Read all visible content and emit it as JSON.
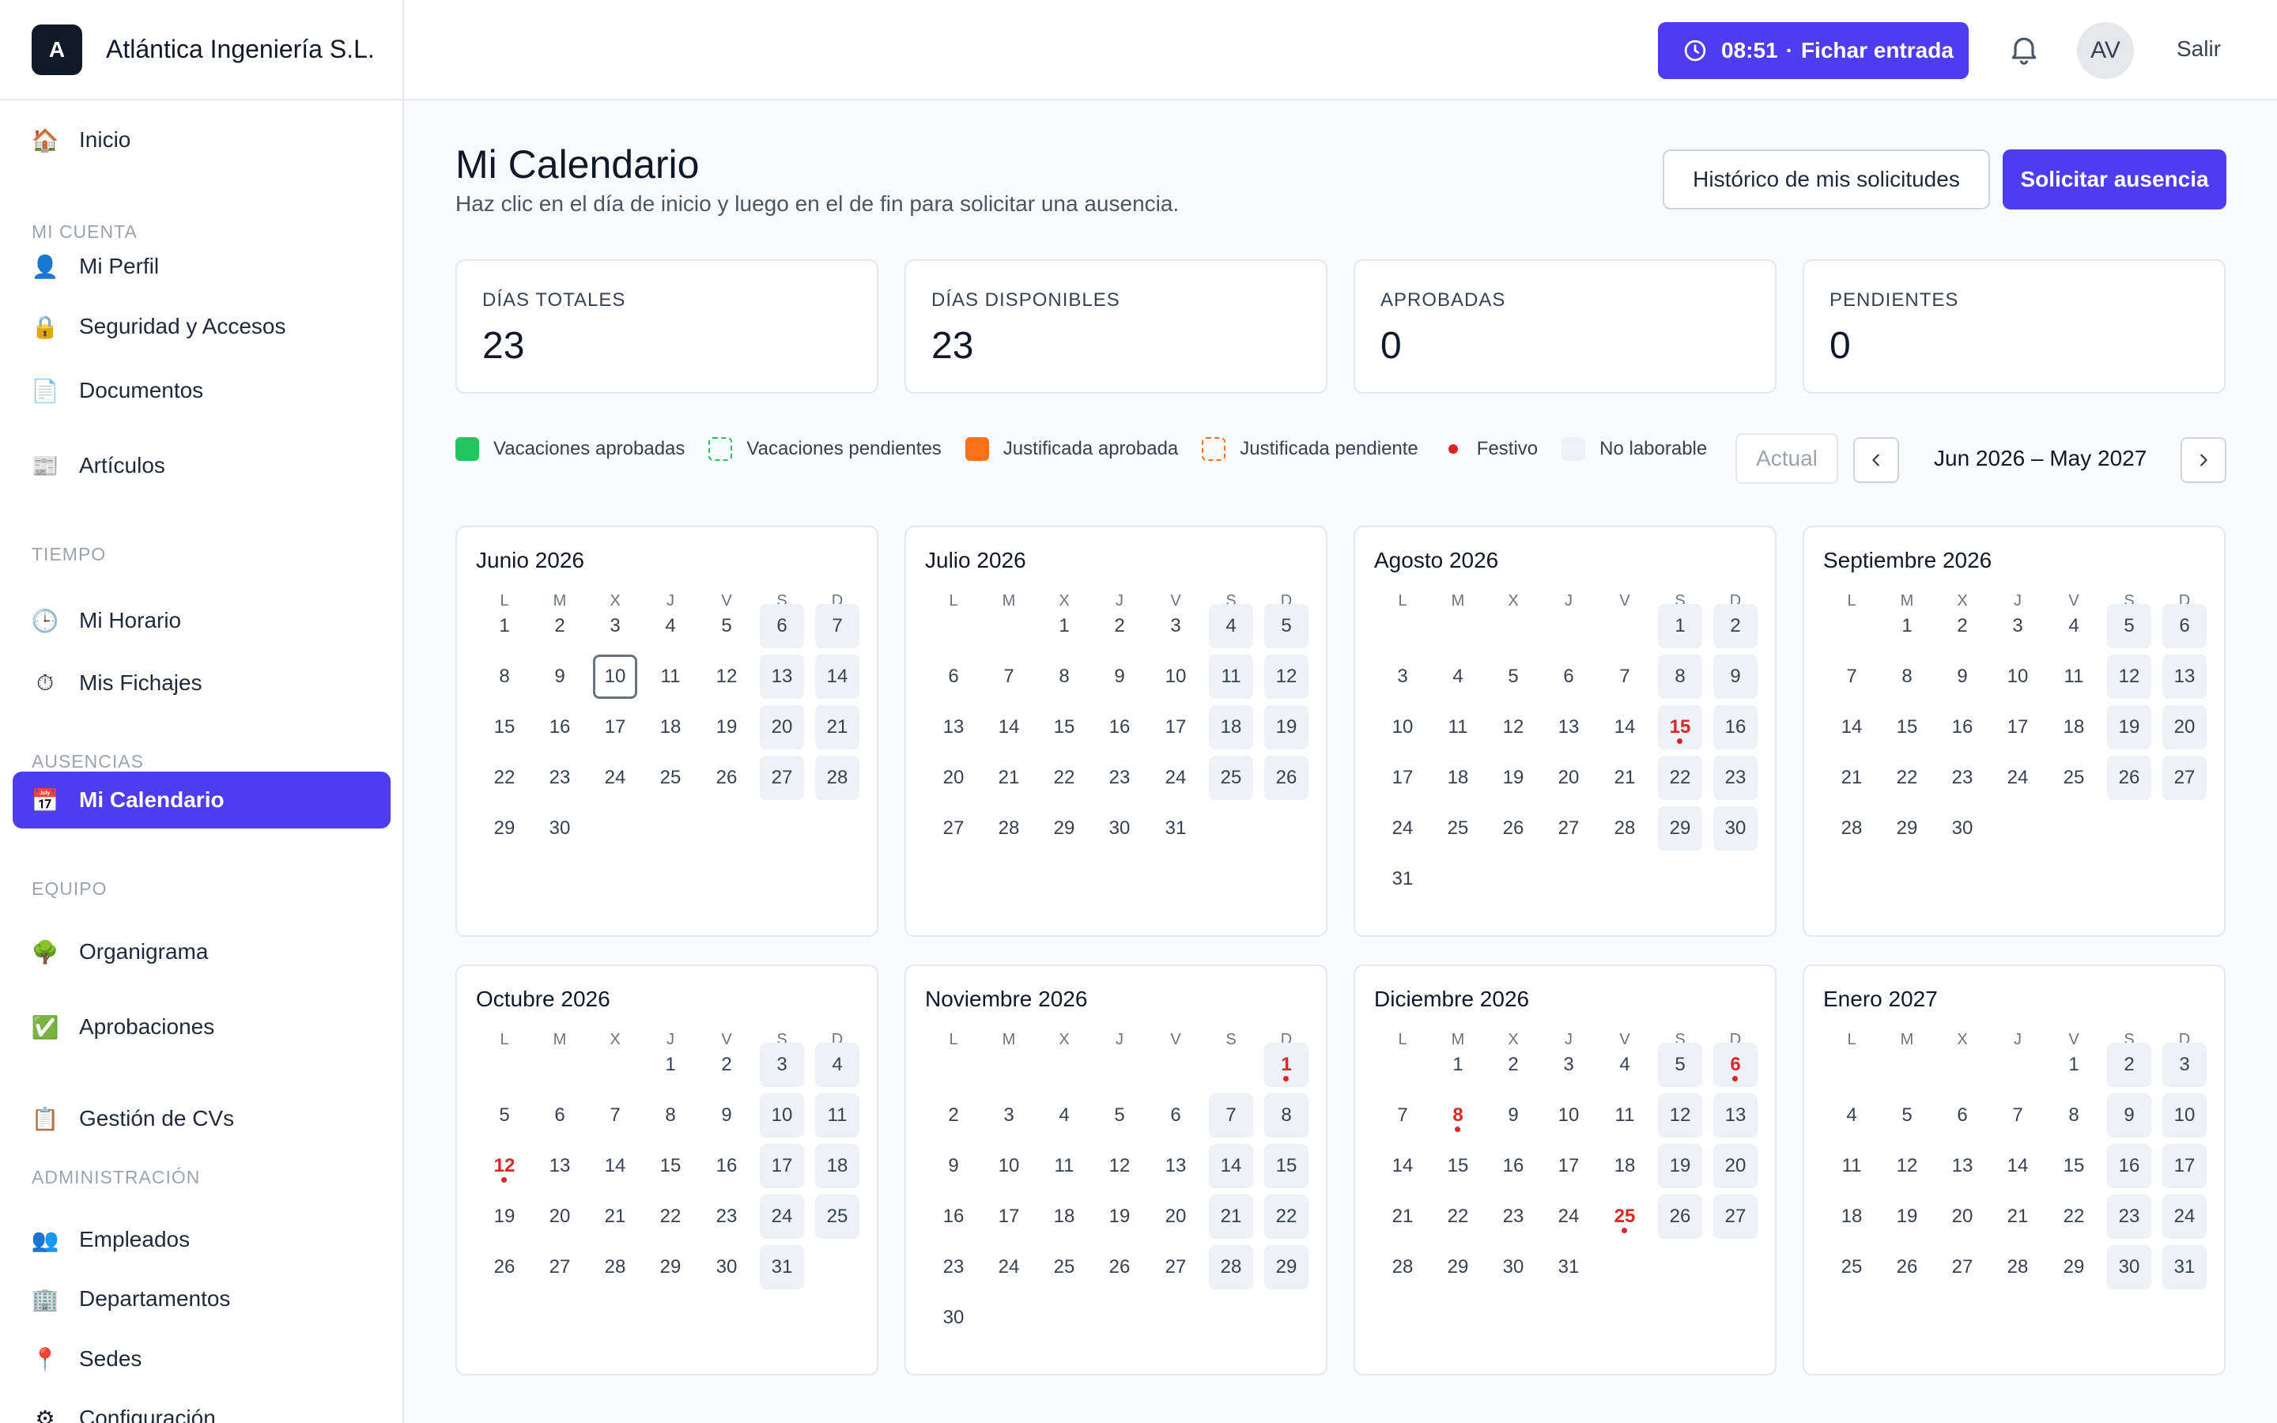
{
  "company": {
    "initial": "A",
    "name": "Atlántica Ingeniería S.L."
  },
  "topbar": {
    "clock_time": "08:51",
    "clock_action": "Fichar entrada",
    "avatar_initials": "AV",
    "logout": "Salir"
  },
  "sidebar": {
    "items": [
      {
        "label": "Inicio",
        "icon": "house-icon",
        "glyph": "🏠"
      },
      {
        "section": "Mi cuenta"
      },
      {
        "label": "Mi Perfil",
        "icon": "user-icon",
        "glyph": "👤"
      },
      {
        "label": "Seguridad y Accesos",
        "icon": "lock-icon",
        "glyph": "🔒"
      },
      {
        "label": "Documentos",
        "icon": "document-icon",
        "glyph": "📄"
      },
      {
        "label": "Artículos",
        "icon": "newspaper-icon",
        "glyph": "📰"
      },
      {
        "section": "Tiempo"
      },
      {
        "label": "Mi Horario",
        "icon": "clock-icon",
        "glyph": "🕒"
      },
      {
        "label": "Mis Fichajes",
        "icon": "stopwatch-icon",
        "glyph": "⏱"
      },
      {
        "section": "Ausencias"
      },
      {
        "label": "Mi Calendario",
        "icon": "calendar-icon",
        "glyph": "📅",
        "active": true
      },
      {
        "section": "Equipo"
      },
      {
        "label": "Organigrama",
        "icon": "tree-icon",
        "glyph": "🌳"
      },
      {
        "label": "Aprobaciones",
        "icon": "check-box-icon",
        "glyph": "✅"
      },
      {
        "label": "Gestión de CVs",
        "icon": "clipboard-icon",
        "glyph": "📋"
      },
      {
        "section": "Administración"
      },
      {
        "label": "Empleados",
        "icon": "users-icon",
        "glyph": "👥"
      },
      {
        "label": "Departamentos",
        "icon": "building-icon",
        "glyph": "🏢"
      },
      {
        "label": "Sedes",
        "icon": "map-pin-icon",
        "glyph": "📍"
      },
      {
        "label": "Configuración",
        "icon": "gear-icon",
        "glyph": "⚙"
      }
    ]
  },
  "page": {
    "title": "Mi Calendario",
    "subtitle": "Haz clic en el día de inicio y luego en el de fin para solicitar una ausencia.",
    "history_button": "Histórico de mis solicitudes",
    "request_button": "Solicitar ausencia"
  },
  "stats": [
    {
      "label": "Días totales",
      "value": "23"
    },
    {
      "label": "Días disponibles",
      "value": "23"
    },
    {
      "label": "Aprobadas",
      "value": "0"
    },
    {
      "label": "Pendientes",
      "value": "0"
    }
  ],
  "legend": [
    {
      "label": "Vacaciones aprobadas",
      "color": "#22c55e",
      "style": "solid"
    },
    {
      "label": "Vacaciones pendientes",
      "color": "#22c55e",
      "style": "dashed"
    },
    {
      "label": "Justificada aprobada",
      "color": "#f97316",
      "style": "solid"
    },
    {
      "label": "Justificada pendiente",
      "color": "#f97316",
      "style": "dashed"
    },
    {
      "label": "Festivo",
      "color": "#dc2626",
      "style": "dot"
    },
    {
      "label": "No laborable",
      "color": "#eef1f5",
      "style": "solid"
    }
  ],
  "calendar_nav": {
    "current": "Actual",
    "range": "Jun 2026 – May 2027"
  },
  "weekdays": [
    "L",
    "M",
    "X",
    "J",
    "V",
    "S",
    "D"
  ],
  "months": [
    {
      "title": "Junio 2026",
      "offset": 0,
      "days": 30,
      "holidays": [],
      "today": 10
    },
    {
      "title": "Julio 2026",
      "offset": 2,
      "days": 31,
      "holidays": []
    },
    {
      "title": "Agosto 2026",
      "offset": 5,
      "days": 31,
      "holidays": [
        15
      ]
    },
    {
      "title": "Septiembre 2026",
      "offset": 1,
      "days": 30,
      "holidays": []
    },
    {
      "title": "Octubre 2026",
      "offset": 3,
      "days": 31,
      "holidays": [
        12
      ]
    },
    {
      "title": "Noviembre 2026",
      "offset": 6,
      "days": 30,
      "holidays": [
        1
      ]
    },
    {
      "title": "Diciembre 2026",
      "offset": 1,
      "days": 31,
      "holidays": [
        6,
        8,
        25
      ]
    },
    {
      "title": "Enero 2027",
      "offset": 4,
      "days": 31,
      "holidays": []
    }
  ]
}
